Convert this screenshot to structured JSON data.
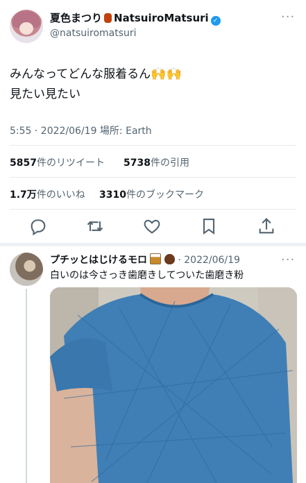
{
  "tweet": {
    "display_name": "夏色まつり",
    "display_name_en": "NatsuiroMatsuri",
    "handle": "@natsuiromatsuri",
    "text_line1": "みんなってどんな服着るん",
    "text_line2": "見たい見たい",
    "emoji": "🙌🙌",
    "timestamp": "5:55 · 2022/06/19 場所: Earth",
    "retweets_count": "5857",
    "retweets_label": "件のリツイート",
    "quotes_count": "5738",
    "quotes_label": "件の引用",
    "likes_count": "1.7万",
    "likes_label": "件のいいね",
    "bookmarks_count": "3310",
    "bookmarks_label": "件のブックマーク"
  },
  "reply": {
    "display_name": "プチッとはじけるモロ",
    "date": "2022/06/19",
    "text": "白いのは今さっき歯磨きしてついた歯磨き粉"
  },
  "colors": {
    "accent": "#1d9bf0",
    "muted": "#536471",
    "divider": "#e6ebef",
    "shirt": "#3f7fb6"
  },
  "icons": [
    "reply-icon",
    "retweet-icon",
    "like-icon",
    "bookmark-icon",
    "share-icon",
    "verified-badge",
    "more-icon"
  ]
}
